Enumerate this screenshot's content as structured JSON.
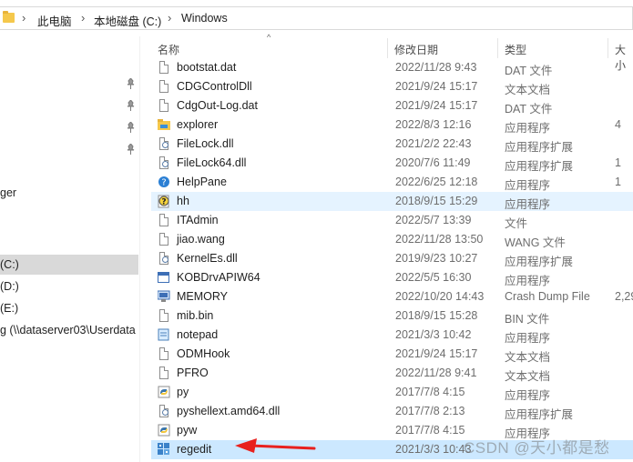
{
  "address_bar": {
    "crumbs": [
      "此电脑",
      "本地磁盘 (C:)",
      "Windows"
    ],
    "separator": "›"
  },
  "nav_pane": {
    "items": [
      {
        "label": "ger",
        "pinned": false
      },
      {
        "label": "(C:)",
        "selected": true
      },
      {
        "label": "(D:)"
      },
      {
        "label": "(E:)"
      },
      {
        "label": "g (\\\\dataserver03\\Userdata"
      }
    ],
    "pin_count": 4
  },
  "columns": {
    "name": "名称",
    "date": "修改日期",
    "type": "类型",
    "size": "大小"
  },
  "files": [
    {
      "name": "bootstat.dat",
      "date": "2022/11/28 9:43",
      "type": "DAT 文件",
      "size": "",
      "icon": "file-icon"
    },
    {
      "name": "CDGControlDll",
      "date": "2021/9/24 15:17",
      "type": "文本文档",
      "size": "",
      "icon": "file-icon"
    },
    {
      "name": "CdgOut-Log.dat",
      "date": "2021/9/24 15:17",
      "type": "DAT 文件",
      "size": "",
      "icon": "file-icon"
    },
    {
      "name": "explorer",
      "date": "2022/8/3 12:16",
      "type": "应用程序",
      "size": "4",
      "icon": "explorer-folder-icon"
    },
    {
      "name": "FileLock.dll",
      "date": "2021/2/2 22:43",
      "type": "应用程序扩展",
      "size": "",
      "icon": "dll-icon"
    },
    {
      "name": "FileLock64.dll",
      "date": "2020/7/6 11:49",
      "type": "应用程序扩展",
      "size": "1",
      "icon": "dll-icon"
    },
    {
      "name": "HelpPane",
      "date": "2022/6/25 12:18",
      "type": "应用程序",
      "size": "1",
      "icon": "help-icon"
    },
    {
      "name": "hh",
      "date": "2018/9/15 15:29",
      "type": "应用程序",
      "size": "",
      "icon": "help-question-icon",
      "hover": true
    },
    {
      "name": "ITAdmin",
      "date": "2022/5/7 13:39",
      "type": "文件",
      "size": "",
      "icon": "file-icon"
    },
    {
      "name": "jiao.wang",
      "date": "2022/11/28 13:50",
      "type": "WANG 文件",
      "size": "",
      "icon": "file-icon"
    },
    {
      "name": "KernelEs.dll",
      "date": "2019/9/23 10:27",
      "type": "应用程序扩展",
      "size": "",
      "icon": "dll-icon"
    },
    {
      "name": "KOBDrvAPIW64",
      "date": "2022/5/5 16:30",
      "type": "应用程序",
      "size": "",
      "icon": "exe-window-icon"
    },
    {
      "name": "MEMORY",
      "date": "2022/10/20 14:43",
      "type": "Crash Dump File",
      "size": "2,29",
      "icon": "crash-dump-icon"
    },
    {
      "name": "mib.bin",
      "date": "2018/9/15 15:28",
      "type": "BIN 文件",
      "size": "",
      "icon": "file-icon"
    },
    {
      "name": "notepad",
      "date": "2021/3/3 10:42",
      "type": "应用程序",
      "size": "",
      "icon": "notepad-icon"
    },
    {
      "name": "ODMHook",
      "date": "2021/9/24 15:17",
      "type": "文本文档",
      "size": "",
      "icon": "file-icon"
    },
    {
      "name": "PFRO",
      "date": "2022/11/28 9:41",
      "type": "文本文档",
      "size": "",
      "icon": "file-icon"
    },
    {
      "name": "py",
      "date": "2017/7/8 4:15",
      "type": "应用程序",
      "size": "",
      "icon": "python-icon"
    },
    {
      "name": "pyshellext.amd64.dll",
      "date": "2017/7/8 2:13",
      "type": "应用程序扩展",
      "size": "",
      "icon": "dll-icon"
    },
    {
      "name": "pyw",
      "date": "2017/7/8 4:15",
      "type": "应用程序",
      "size": "",
      "icon": "python-icon"
    },
    {
      "name": "regedit",
      "date": "2021/3/3 10:43",
      "type": "",
      "size": "",
      "icon": "regedit-icon",
      "selected": true
    }
  ],
  "annotation": {
    "arrow_color": "#e8211e"
  },
  "watermark": "CSDN @天小都是愁",
  "colors": {
    "selected_row": "#cce8ff",
    "hover_row": "#e5f3ff",
    "nav_selected": "#d9d9d9"
  }
}
